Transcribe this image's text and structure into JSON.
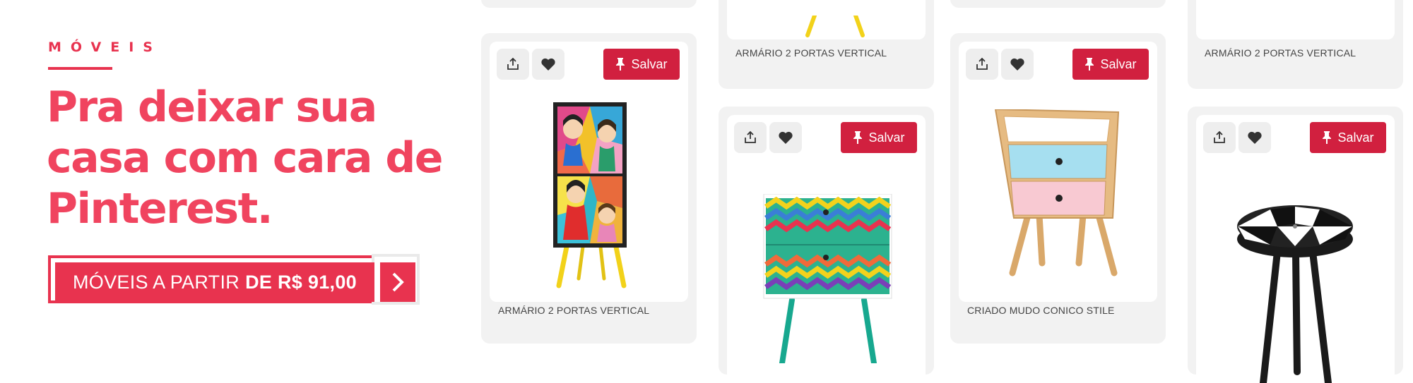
{
  "promo": {
    "eyebrow": "MÓVEIS",
    "headline": "Pra deixar sua casa com cara de Pinterest.",
    "cta": {
      "prefix": "MÓVEIS A PARTIR",
      "price": "DE R$ 91,00"
    }
  },
  "actions": {
    "save_label": "Salvar"
  },
  "products": [
    {
      "label": "ARMÁRIO 2 PORTAS VERTICAL",
      "image": "comic-armario"
    },
    {
      "label": "ARMÁRIO 2 PORTAS VERTICAL",
      "image": "armario-yellow-legs"
    },
    {
      "label": "",
      "image": "chevron-gaveteiro"
    },
    {
      "label": "CRIADO MUDO CONICO STILE",
      "image": "criado-mudo-pastel"
    },
    {
      "label": "ARMÁRIO 2 PORTAS VERTICAL",
      "image": "armario-partial"
    },
    {
      "label": "",
      "image": "banqueta-preto-branco"
    }
  ],
  "colors": {
    "brand": "#e8334f",
    "save": "#d1203f",
    "card_bg": "#f2f2f2"
  }
}
